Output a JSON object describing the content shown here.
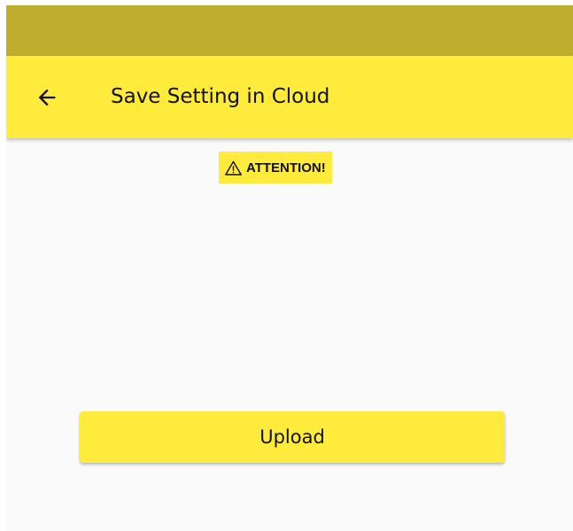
{
  "colors": {
    "status_bar": "#bfae2e",
    "primary": "#ffeb3b",
    "background": "#fafafa",
    "text": "#111111"
  },
  "app_bar": {
    "back_icon": "arrow-back-icon",
    "title": "Save Setting in Cloud"
  },
  "notice": {
    "icon": "warning-triangle-icon",
    "text": "ATTENTION!"
  },
  "actions": {
    "upload_label": "Upload"
  }
}
